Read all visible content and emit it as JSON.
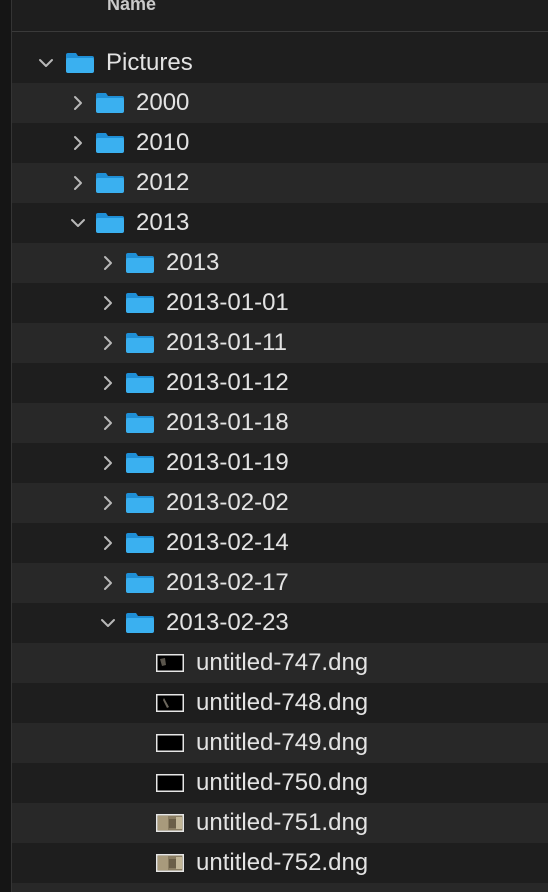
{
  "header": {
    "name_label": "Name"
  },
  "rows": [
    {
      "label": "Pictures",
      "expanded": true
    },
    {
      "label": "2000",
      "expanded": false
    },
    {
      "label": "2010",
      "expanded": false
    },
    {
      "label": "2012",
      "expanded": false
    },
    {
      "label": "2013",
      "expanded": true
    },
    {
      "label": "2013",
      "expanded": false
    },
    {
      "label": "2013-01-01",
      "expanded": false
    },
    {
      "label": "2013-01-11",
      "expanded": false
    },
    {
      "label": "2013-01-12",
      "expanded": false
    },
    {
      "label": "2013-01-18",
      "expanded": false
    },
    {
      "label": "2013-01-19",
      "expanded": false
    },
    {
      "label": "2013-02-02",
      "expanded": false
    },
    {
      "label": "2013-02-14",
      "expanded": false
    },
    {
      "label": "2013-02-17",
      "expanded": false
    },
    {
      "label": "2013-02-23",
      "expanded": true
    },
    {
      "label": "untitled-747.dng",
      "thumb": "dark-corner"
    },
    {
      "label": "untitled-748.dng",
      "thumb": "dark-shape"
    },
    {
      "label": "untitled-749.dng",
      "thumb": "black"
    },
    {
      "label": "untitled-750.dng",
      "thumb": "black"
    },
    {
      "label": "untitled-751.dng",
      "thumb": "photo"
    },
    {
      "label": "untitled-752.dng",
      "thumb": "photo"
    }
  ],
  "colors": {
    "folder_body": "#3ab0f0",
    "folder_tab": "#1f8fd6",
    "text": "#e3e3e3",
    "chevron": "#b8b8b8"
  },
  "icons": {
    "folder": "folder-icon",
    "file": "image-file-icon",
    "chevron_right": "chevron-right-icon",
    "chevron_down": "chevron-down-icon"
  }
}
